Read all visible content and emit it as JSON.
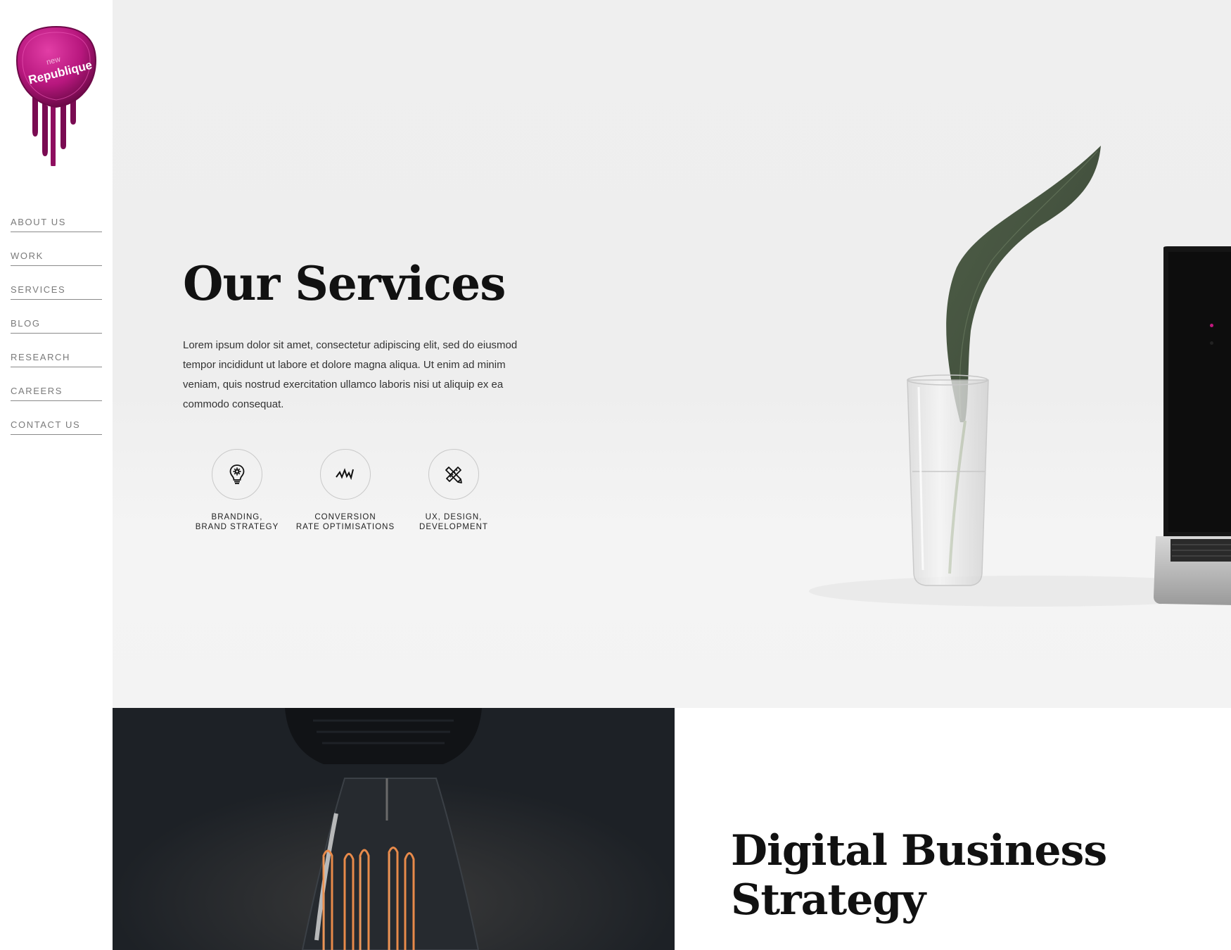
{
  "logo": {
    "small_text": "new",
    "text": "Republique",
    "colors": {
      "primary": "#b8177e",
      "dark": "#7a0b52"
    }
  },
  "nav": {
    "items": [
      {
        "label": "ABOUT US"
      },
      {
        "label": "WORK"
      },
      {
        "label": "SERVICES"
      },
      {
        "label": "BLOG"
      },
      {
        "label": "RESEARCH"
      },
      {
        "label": "CAREERS"
      },
      {
        "label": "CONTACT US"
      }
    ]
  },
  "hero": {
    "title": "Our Services",
    "description": "Lorem ipsum dolor sit amet, consectetur adipiscing elit, sed do eiusmod tempor incididunt ut labore et dolore magna aliqua. Ut enim ad minim veniam, quis nostrud exercitation ullamco laboris nisi ut aliquip ex ea commodo consequat.",
    "services": [
      {
        "icon": "lightbulb-gear-icon",
        "line1": "BRANDING,",
        "line2": "BRAND STRATEGY"
      },
      {
        "icon": "activity-zigzag-icon",
        "line1": "CONVERSION",
        "line2": "RATE OPTIMISATIONS"
      },
      {
        "icon": "pencil-ruler-icon",
        "line1": "UX, DESIGN,",
        "line2": "DEVELOPMENT"
      }
    ],
    "slider_dots": {
      "active_color": "#c2187f",
      "inactive_color": "#222222"
    }
  },
  "section": {
    "title": "Digital Business Strategy"
  }
}
